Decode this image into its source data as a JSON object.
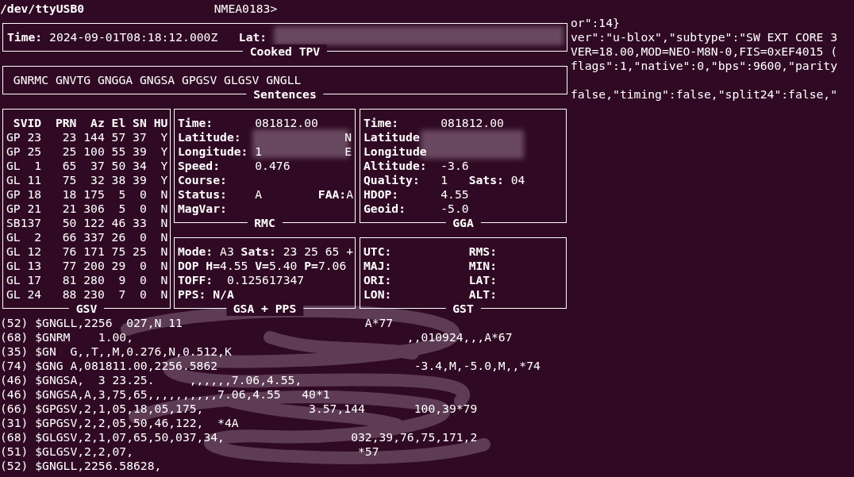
{
  "header": {
    "device": "/dev/ttyUSB0",
    "prompt": "NMEA0183>"
  },
  "cooked_tpv": {
    "title": "Cooked TPV",
    "fields": [
      {
        "label": "Time:",
        "value": "2024-09-01T08:18:12.000Z"
      },
      {
        "label": "Lat:"
      }
    ]
  },
  "sentences": {
    "title": "Sentences",
    "text": "GNRMC GNVTG GNGGA GNGSA GPGSV GLGSV GNGLL"
  },
  "gsv": {
    "title": "GSV",
    "columns": [
      "SVID",
      "PRN",
      "Az",
      "El",
      "SN",
      "HU"
    ],
    "rows": [
      [
        "GP 23",
        "23",
        "144",
        "57",
        "37",
        "Y"
      ],
      [
        "GP 25",
        "25",
        "100",
        "55",
        "39",
        "Y"
      ],
      [
        "GL  1",
        "65",
        "37",
        "50",
        "34",
        "Y"
      ],
      [
        "GL 11",
        "75",
        "32",
        "38",
        "39",
        "Y"
      ],
      [
        "GP 18",
        "18",
        "175",
        "5",
        "0",
        "N"
      ],
      [
        "GP 21",
        "21",
        "306",
        "5",
        "0",
        "N"
      ],
      [
        "SB137",
        "50",
        "122",
        "46",
        "33",
        "N"
      ],
      [
        "GL  2",
        "66",
        "337",
        "26",
        "0",
        "N"
      ],
      [
        "GL 12",
        "76",
        "171",
        "75",
        "25",
        "N"
      ],
      [
        "GL 13",
        "77",
        "200",
        "29",
        "0",
        "N"
      ],
      [
        "GL 17",
        "81",
        "280",
        "9",
        "0",
        "N"
      ],
      [
        "GL 24",
        "88",
        "230",
        "7",
        "0",
        "N"
      ]
    ]
  },
  "rmc": {
    "title": "RMC",
    "rows": [
      {
        "label": "Time:",
        "value": "081812.00"
      },
      {
        "label": "Latitude:",
        "suffix": "N"
      },
      {
        "label": "Longitude:",
        "value": "1",
        "suffix": "E"
      },
      {
        "label": "Speed:",
        "value": "0.476"
      },
      {
        "label": "Course:"
      },
      {
        "label": "Status:",
        "value": "A",
        "extra_label": "FAA:",
        "extra_value": "A"
      },
      {
        "label": "MagVar:"
      }
    ]
  },
  "gga": {
    "title": "GGA",
    "rows": [
      {
        "label": "Time:",
        "value": "081812.00"
      },
      {
        "label": "Latitude"
      },
      {
        "label": "Longitude"
      },
      {
        "label": "Altitude:",
        "value": "-3.6"
      },
      {
        "label": "Quality:",
        "value": "1",
        "extra_label": "Sats:",
        "extra_value": "04"
      },
      {
        "label": "HDOP:",
        "value": "4.55"
      },
      {
        "label": "Geoid:",
        "value": "-5.0"
      }
    ]
  },
  "gsa_pps": {
    "title": "GSA + PPS",
    "lines": [
      {
        "text": "**Mode:** A3 **Sats:** 23 25 65 +",
        "bold": false
      },
      {
        "text": "**DOP H=**4.55 **V=**5.40 **P=**7.06",
        "bold": false
      },
      {
        "text": "**TOFF:**  0.125617347",
        "bold": false
      },
      {
        "text": "PPS: N/A",
        "bold": true
      }
    ]
  },
  "gst": {
    "title": "GST",
    "rows": [
      [
        "UTC:",
        "RMS:"
      ],
      [
        "MAJ:",
        "MIN:"
      ],
      [
        "ORI:",
        "LAT:"
      ],
      [
        "LON:",
        "ALT:"
      ]
    ]
  },
  "log": [
    "(52) $GNGLL,2256  027,N 11                          A*77",
    "(68) $GNRM    1.00,                                       ,,010924,,,A*67",
    "(35) $GN  G,,T,,M,0.276,N,0.512,K",
    "(74) $GNG A,081811.00,2256.5862                            -3.4,M,-5.0,M,,*74",
    "(46) $GNGSA,  3 23.25.     ,,,,,,7.06,4.55,",
    "(46) $GNGSA,A,3,75,65,,,,,,,,,,7.06,4.55   40*1",
    "(66) $GPGSV,2,1,05,18,05,175,               3.57,144       100,39*79",
    "(31) $GPGSV,2,2,05,50,46,122,  *4A",
    "(68) $GLGSV,2,1,07,65,50,037,34,                  032,39,76,75,171,2",
    "(51) $GLGSV,2,2,07,                                *57",
    "(52) $GNGLL,2256.58628,"
  ],
  "right_pane": {
    "blocks": [
      [
        "or\":14}",
        "ver\":\"u-blox\",\"subtype\":\"SW EXT CORE 3",
        "VER=18.00,MOD=NEO-M8N-0,FIS=0xEF4015 (",
        "flags\":1,\"native\":0,\"bps\":9600,\"parity"
      ],
      [
        "false,\"timing\":false,\"split24\":false,\""
      ]
    ]
  }
}
